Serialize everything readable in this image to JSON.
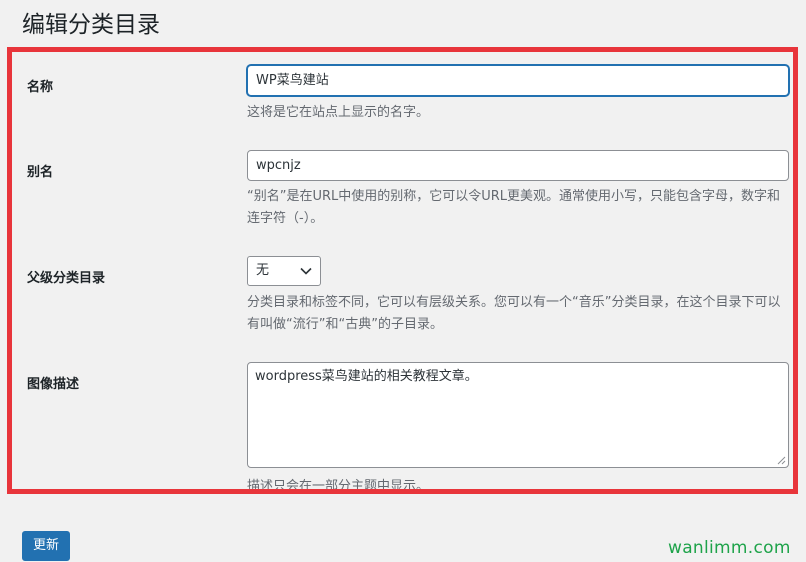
{
  "page": {
    "title": "编辑分类目录"
  },
  "form": {
    "name": {
      "label": "名称",
      "value": "WP菜鸟建站",
      "description": "这将是它在站点上显示的名字。"
    },
    "slug": {
      "label": "别名",
      "value": "wpcnjz",
      "description": "“别名”是在URL中使用的别称，它可以令URL更美观。通常使用小写，只能包含字母，数字和连字符（-）。"
    },
    "parent": {
      "label": "父级分类目录",
      "selected": "无",
      "description": "分类目录和标签不同，它可以有层级关系。您可以有一个“音乐”分类目录，在这个目录下可以有叫做“流行”和“古典”的子目录。"
    },
    "description": {
      "label": "图像描述",
      "value": "wordpress菜鸟建站的相关教程文章。",
      "description": "描述只会在一部分主题中显示。"
    }
  },
  "actions": {
    "update_label": "更新"
  },
  "watermark": {
    "text": "wanlimm.com"
  },
  "colors": {
    "highlight": "#e8353b",
    "primary": "#2271b1",
    "watermark": "#1ea34a"
  }
}
